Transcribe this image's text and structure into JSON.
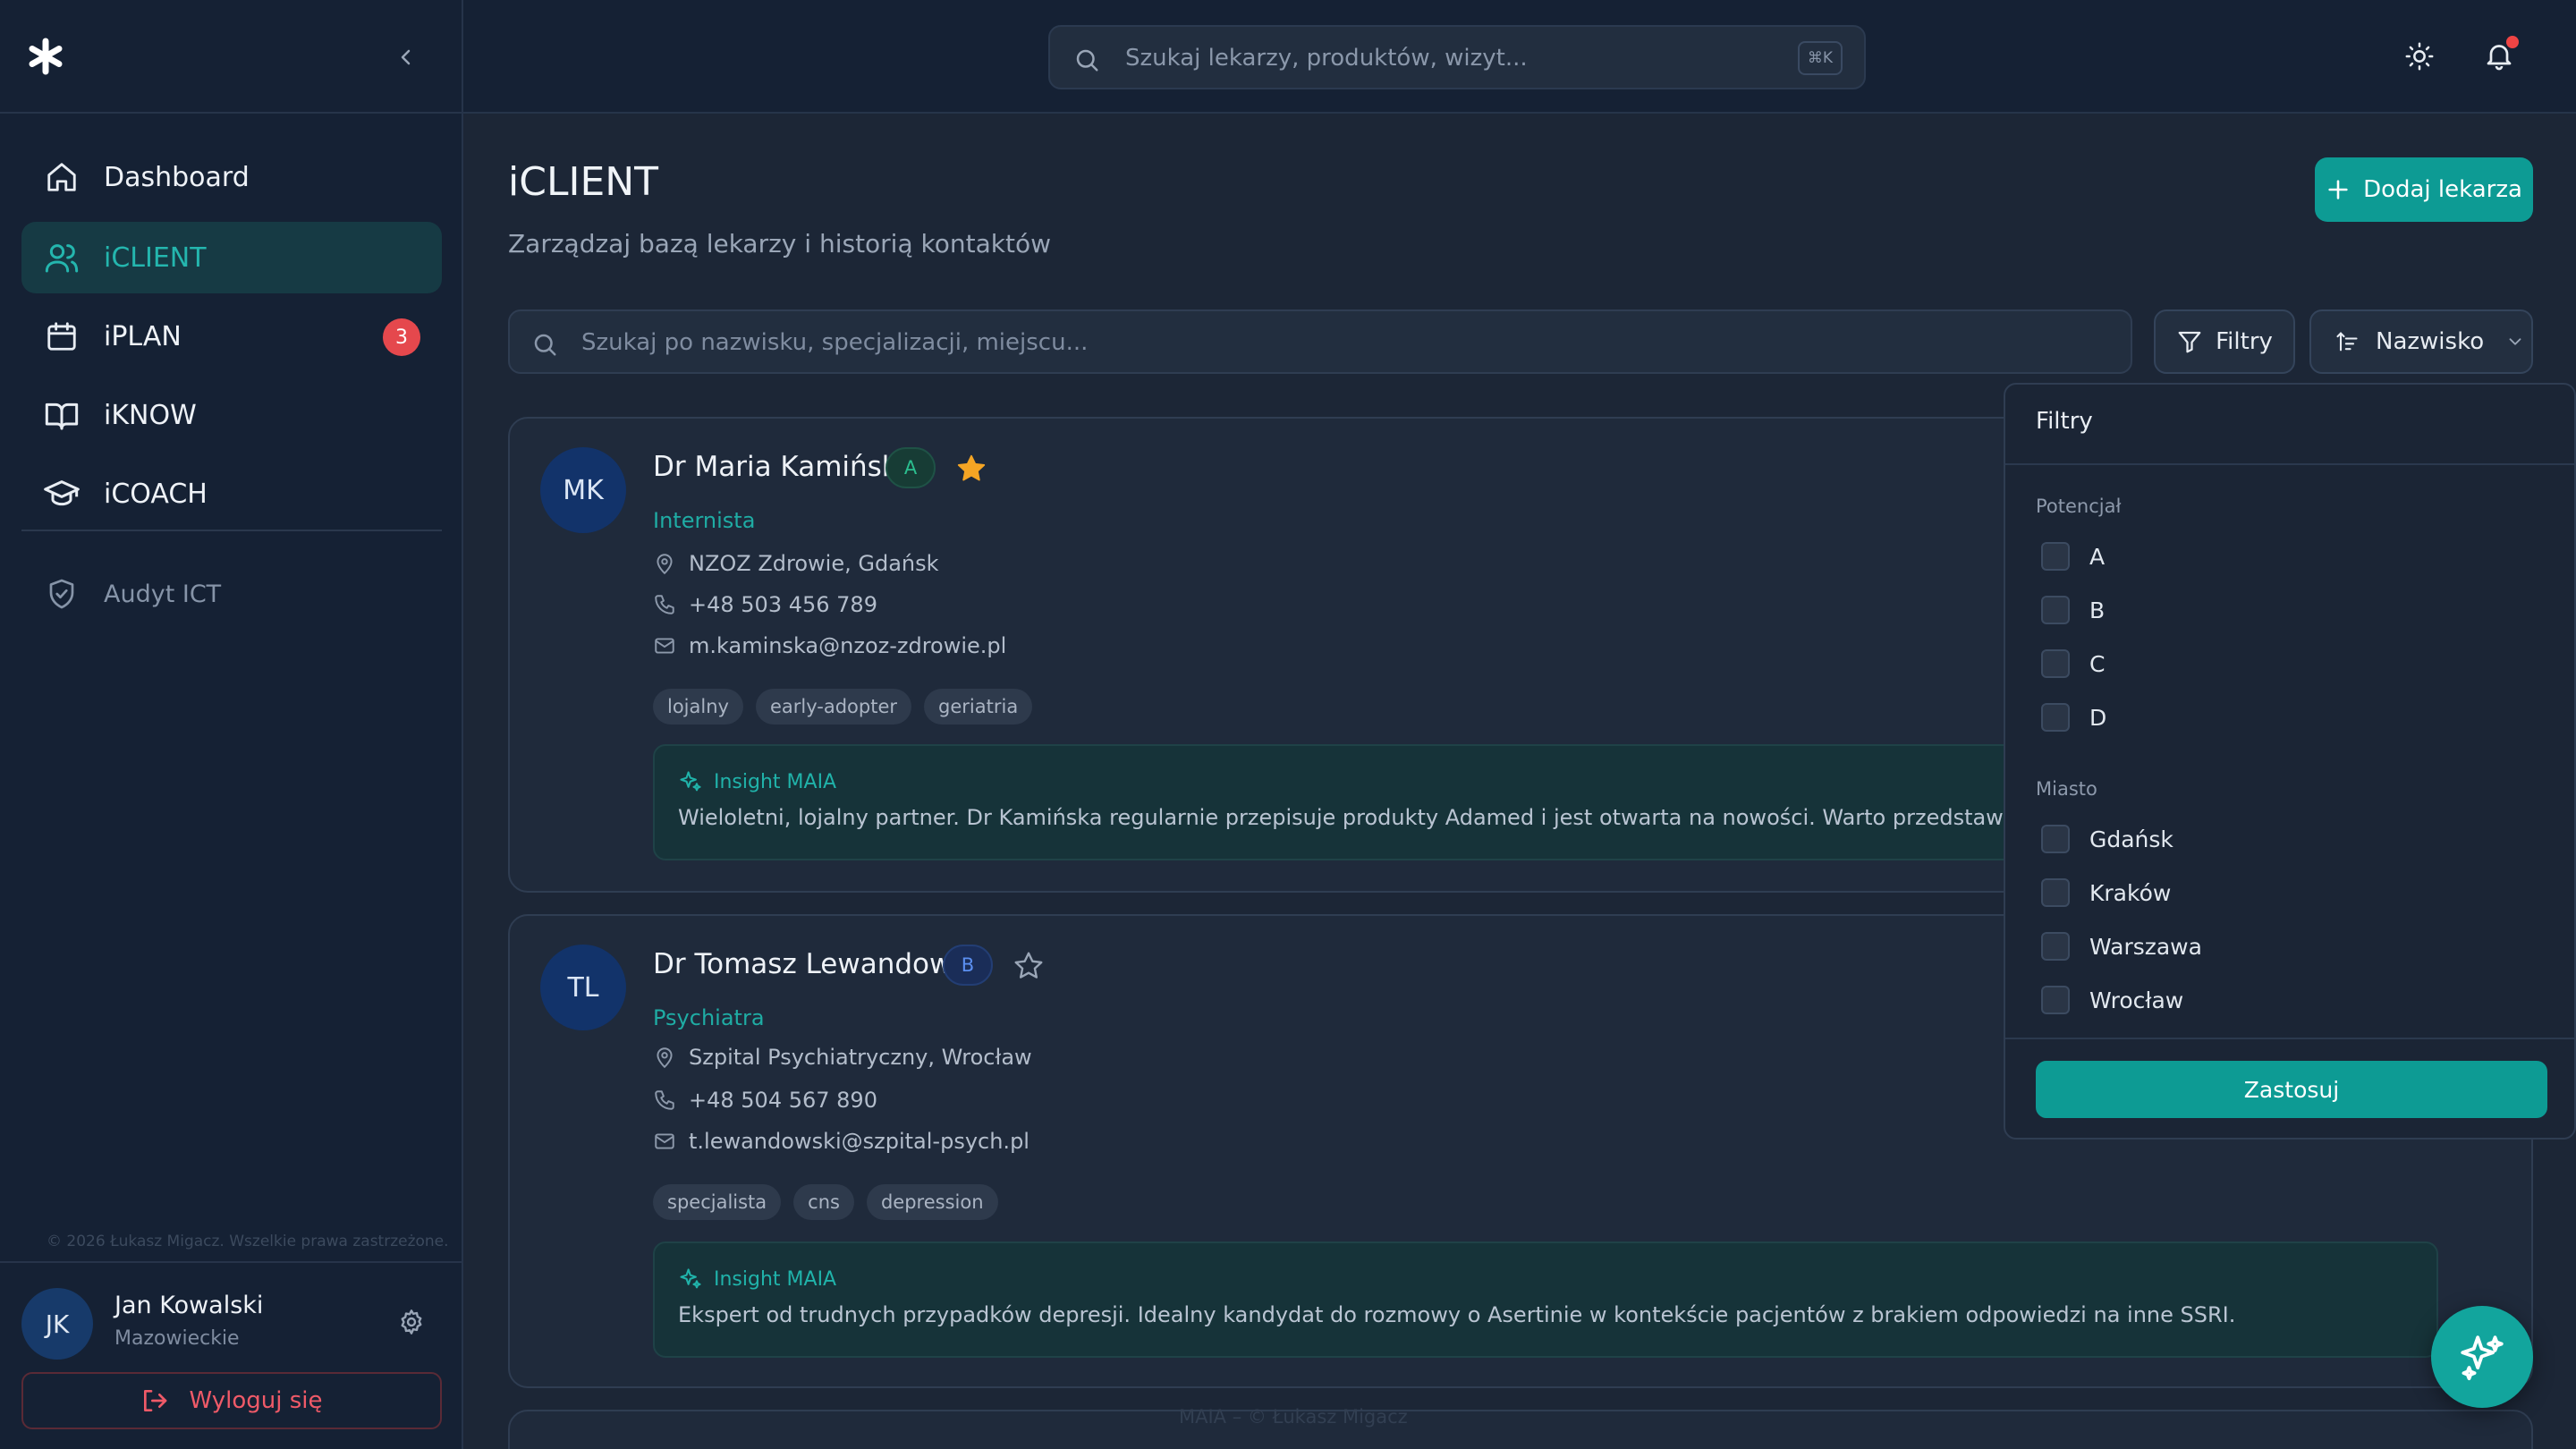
{
  "colors": {
    "accent": "#0d9b94",
    "danger": "#e5484d",
    "bg": "#1c2636"
  },
  "sidebar": {
    "items": [
      {
        "label": "Dashboard",
        "icon": "home-icon"
      },
      {
        "label": "iCLIENT",
        "icon": "users-icon",
        "active": true
      },
      {
        "label": "iPLAN",
        "icon": "calendar-icon",
        "badge": "3"
      },
      {
        "label": "iKNOW",
        "icon": "book-icon"
      },
      {
        "label": "iCOACH",
        "icon": "graduation-cap-icon"
      }
    ],
    "audit_label": "Audyt ICT",
    "copyright": "© 2026 Łukasz Migacz. Wszelkie prawa zastrzeżone.",
    "user": {
      "initials": "JK",
      "name": "Jan Kowalski",
      "region": "Mazowieckie"
    },
    "logout_label": "Wyloguj się"
  },
  "topbar": {
    "search_placeholder": "Szukaj lekarzy, produktów, wizyt...",
    "shortcut": "⌘K"
  },
  "main": {
    "title": "iCLIENT",
    "subtitle": "Zarządzaj bazą lekarzy i historią kontaktów",
    "add_button": "Dodaj lekarza",
    "search_placeholder": "Szukaj po nazwisku, specjalizacji, miejscu...",
    "filter_button": "Filtry",
    "sort_button": "Nazwisko",
    "footer": "MAIA – © Łukasz Migacz"
  },
  "doctors": [
    {
      "initials": "MK",
      "name": "Dr Maria Kamińska",
      "potential": "A",
      "starred": true,
      "specialty": "Internista",
      "location": "NZOZ Zdrowie, Gdańsk",
      "phone": "+48 503 456 789",
      "email": "m.kaminska@nzoz-zdrowie.pl",
      "tags": [
        "lojalny",
        "early-adopter",
        "geriatria"
      ],
      "insight_title": "Insight MAIA",
      "insight": "Wieloletni, lojalny partner. Dr Kamińska regularnie przepisuje produkty Adamed i jest otwarta na nowości. Warto przedstawić rozszerzenie portfo"
    },
    {
      "initials": "TL",
      "name": "Dr Tomasz Lewandowski",
      "potential": "B",
      "starred": false,
      "specialty": "Psychiatra",
      "location": "Szpital Psychiatryczny, Wrocław",
      "phone": "+48 504 567 890",
      "email": "t.lewandowski@szpital-psych.pl",
      "tags": [
        "specjalista",
        "cns",
        "depression"
      ],
      "insight_title": "Insight MAIA",
      "insight": "Ekspert od trudnych przypadków depresji. Idealny kandydat do rozmowy o Asertinie w kontekście pacjentów z brakiem odpowiedzi na inne SSRI."
    }
  ],
  "filter_panel": {
    "title": "Filtry",
    "potential_label": "Potencjał",
    "potential_options": [
      "A",
      "B",
      "C",
      "D"
    ],
    "city_label": "Miasto",
    "city_options": [
      "Gdańsk",
      "Kraków",
      "Warszawa",
      "Wrocław"
    ],
    "apply": "Zastosuj"
  }
}
